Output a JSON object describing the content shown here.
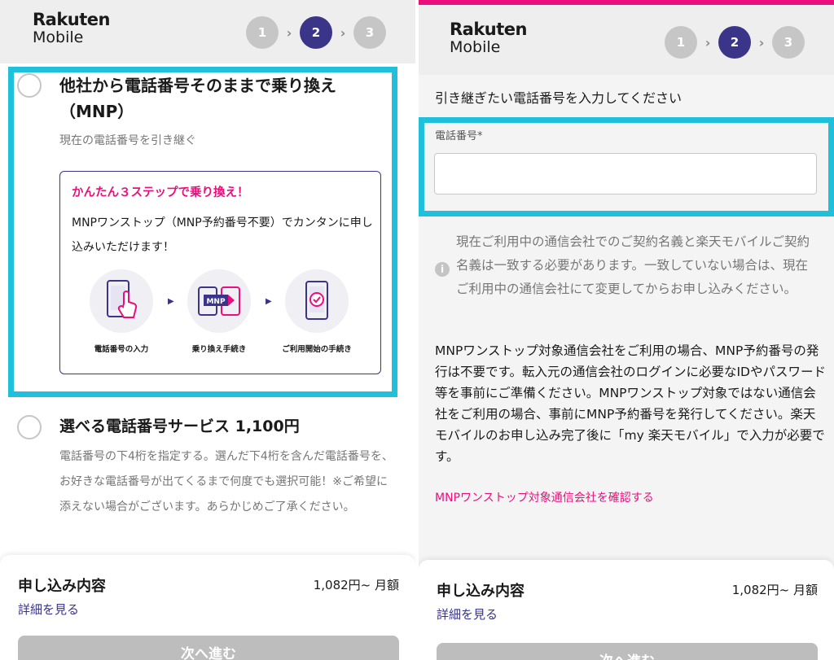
{
  "header": {
    "logo_line1": "Rakuten",
    "logo_line2": "Mobile",
    "steps": [
      "1",
      "2",
      "3"
    ],
    "active_step": 2
  },
  "left": {
    "option_mnp": {
      "title_line1": "他社から電話番号そのままで乗り換え",
      "title_line2": "（MNP）",
      "subtitle": "現在の電話番号を引き継ぐ",
      "box_title": "かんたん３ステップで乗り換え！",
      "box_text": "MNPワンストップ（MNP予約番号不要）でカンタンに申し込みいただけます！",
      "steps": [
        {
          "label": "電話番号の入力",
          "icon": "phone-tap-icon"
        },
        {
          "label": "乗り換え手続き",
          "icon": "mnp-transfer-icon"
        },
        {
          "label": "ご利用開始の手続き",
          "icon": "phone-check-icon"
        }
      ],
      "mnp_badge": "MNP"
    },
    "option_select": {
      "title": "選べる電話番号サービス 1,100円",
      "description": "電話番号の下4桁を指定する。選んだ下4桁を含んだ電話番号を、お好きな電話番号が出てくるまで何度でも選択可能！※ご希望に添えない場合がございます。あらかじめご了承ください。"
    }
  },
  "right": {
    "heading": "引き継ぎたい電話番号を入力してください",
    "phone_label": "電話番号*",
    "phone_value": "",
    "info_note": "現在ご利用中の通信会社でのご契約名義と楽天モバイルご契約名義は一致する必要があります。一致していない場合は、現在ご利用中の通信会社にて変更してからお申し込みください。",
    "body_text": "MNPワンストップ対象通信会社をご利用の場合、MNP予約番号の発行は不要です。転入元の通信会社のログインに必要なIDやパスワード等を事前にご準備ください。MNPワンストップ対象ではない通信会社をご利用の場合、事前にMNP予約番号を発行してください。楽天モバイルのお申し込み完了後に「my 楽天モバイル」で入力が必要です。",
    "link_text": "MNPワンストップ対象通信会社を確認する"
  },
  "summary": {
    "title": "申し込み内容",
    "price": "1,082円~ 月額",
    "details_link": "詳細を見る",
    "next_button": "次へ進む"
  },
  "colors": {
    "brand_purple": "#3a3589",
    "brand_pink": "#eb0f7c",
    "highlight_cyan": "#1fc0dc",
    "step_inactive": "#c6c6c6"
  }
}
